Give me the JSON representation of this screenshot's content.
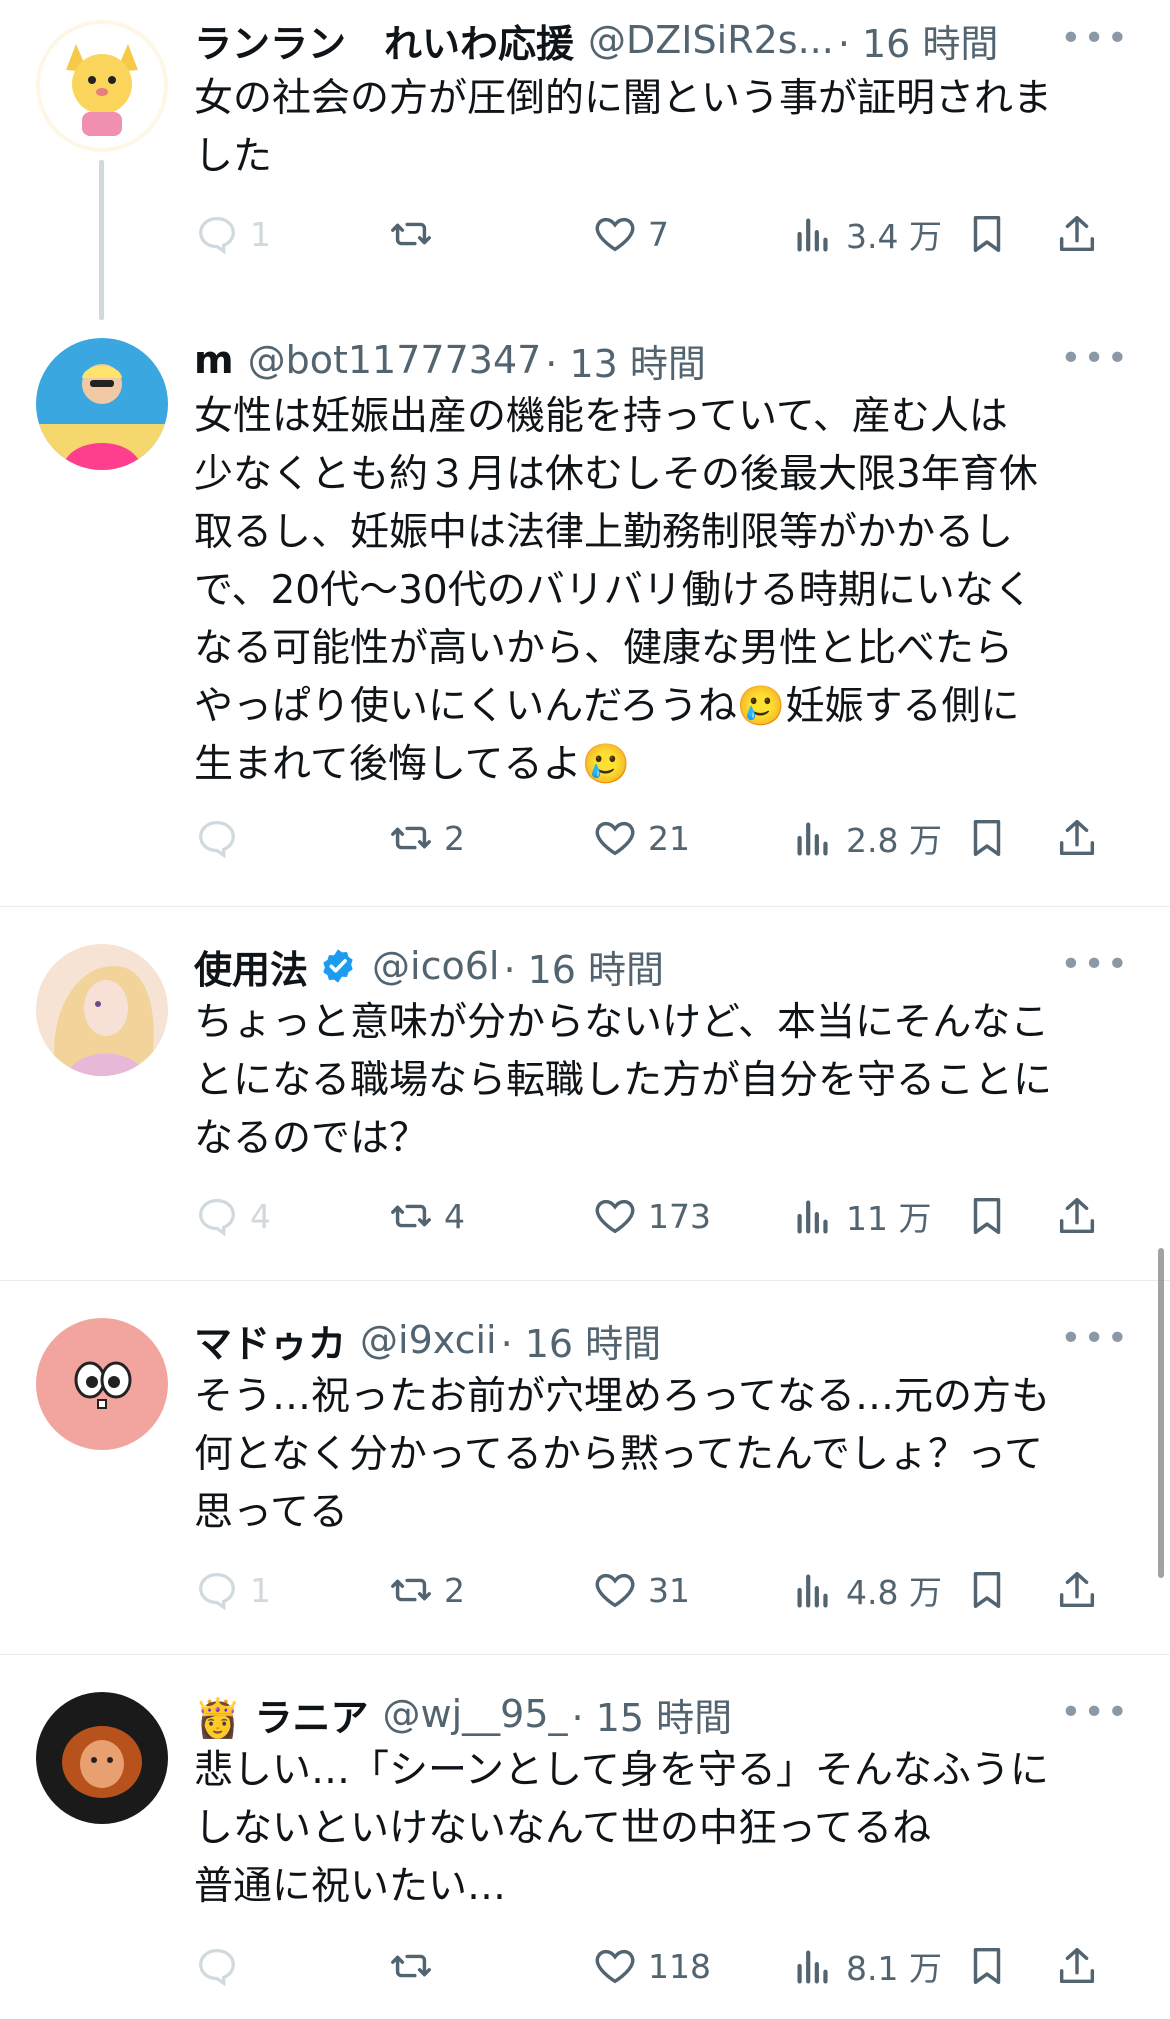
{
  "colors": {
    "text": "#0f1419",
    "muted": "#536471",
    "verified": "#1d9bf0",
    "divider": "#e6ecf0"
  },
  "tweets": [
    {
      "name": "ランラン　れいわ応援",
      "handle": "@DZISiR2s...",
      "time": "· 16 時間",
      "text": "女の社会の方が圧倒的に闇という事が証明されま\nした",
      "replies": "1",
      "retweets": "",
      "likes": "7",
      "views": "3.4 万",
      "avatar_icon": "fox-avatar-icon"
    },
    {
      "name": "m",
      "handle": "@bot11777347",
      "time": "· 13 時間",
      "text": "女性は妊娠出産の機能を持っていて、産む人は\n少なくとも約３月は休むしその後最大限3年育休\n取るし、妊娠中は法律上勤務制限等がかかるし\nで、20代〜30代のバリバリ働ける時期にいなく\nなる可能性が高いから、健康な男性と比べたら\nやっぱり使いにくいんだろうね🥲妊娠する側に\n生まれて後悔してるよ🥲",
      "replies": "",
      "retweets": "2",
      "likes": "21",
      "views": "2.8 万",
      "avatar_icon": "person-avatar-icon"
    },
    {
      "name": "使用法",
      "handle": "@ico6l",
      "time": "· 16 時間",
      "text": "ちょっと意味が分からないけど、本当にそんなこ\nとになる職場なら転職した方が自分を守ることに\nなるのでは？",
      "replies": "4",
      "retweets": "4",
      "likes": "173",
      "views": "11 万",
      "avatar_icon": "anime-girl-avatar-icon"
    },
    {
      "name": "マドゥカ",
      "handle": "@i9xcii",
      "time": "· 16 時間",
      "text": "そう…祝ったお前が穴埋めろってなる…元の方も\n何となく分かってるから黙ってたんでしょ？って\n思ってる",
      "replies": "1",
      "retweets": "2",
      "likes": "31",
      "views": "4.8 万",
      "avatar_icon": "pink-face-avatar-icon"
    },
    {
      "name": "👸 ラニア",
      "handle": "@wj__95_",
      "time": "· 15 時間",
      "text": "悲しい…「シーンとして身を守る」そんなふうに\nしないといけないなんて世の中狂ってるね\n普通に祝いたい…",
      "replies": "",
      "retweets": "",
      "likes": "118",
      "views": "8.1 万",
      "avatar_icon": "princess-avatar-icon"
    }
  ],
  "more_label": "•••"
}
